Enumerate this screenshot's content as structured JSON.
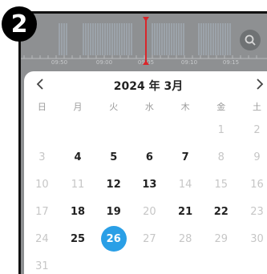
{
  "badge": "2",
  "timeline": {
    "ticks": [
      "09:50",
      "09:00",
      "09:05",
      "09:10",
      "09:15"
    ]
  },
  "calendar": {
    "title": "2024 年 3月",
    "prev_label": "<",
    "next_label": ">",
    "weekdays": [
      "日",
      "月",
      "火",
      "水",
      "木",
      "金",
      "土"
    ],
    "selected_day": "26",
    "accent": "#2a9fe6",
    "weeks": [
      [
        {
          "d": ""
        },
        {
          "d": ""
        },
        {
          "d": ""
        },
        {
          "d": ""
        },
        {
          "d": ""
        },
        {
          "d": "1"
        },
        {
          "d": "2"
        }
      ],
      [
        {
          "d": "3"
        },
        {
          "d": "4",
          "rec": true
        },
        {
          "d": "5",
          "rec": true
        },
        {
          "d": "6",
          "rec": true
        },
        {
          "d": "7",
          "rec": true
        },
        {
          "d": "8"
        },
        {
          "d": "9"
        }
      ],
      [
        {
          "d": "10"
        },
        {
          "d": "11"
        },
        {
          "d": "12",
          "rec": true
        },
        {
          "d": "13",
          "rec": true
        },
        {
          "d": "14"
        },
        {
          "d": "15"
        },
        {
          "d": "16"
        }
      ],
      [
        {
          "d": "17"
        },
        {
          "d": "18",
          "rec": true
        },
        {
          "d": "19",
          "rec": true
        },
        {
          "d": "20"
        },
        {
          "d": "21",
          "rec": true
        },
        {
          "d": "22",
          "rec": true
        },
        {
          "d": "23"
        }
      ],
      [
        {
          "d": "24"
        },
        {
          "d": "25",
          "rec": true
        },
        {
          "d": "26",
          "rec": true,
          "sel": true
        },
        {
          "d": "27"
        },
        {
          "d": "28"
        },
        {
          "d": "29"
        },
        {
          "d": "30"
        }
      ],
      [
        {
          "d": "31"
        },
        {
          "d": ""
        },
        {
          "d": ""
        },
        {
          "d": ""
        },
        {
          "d": ""
        },
        {
          "d": ""
        },
        {
          "d": ""
        }
      ]
    ]
  }
}
